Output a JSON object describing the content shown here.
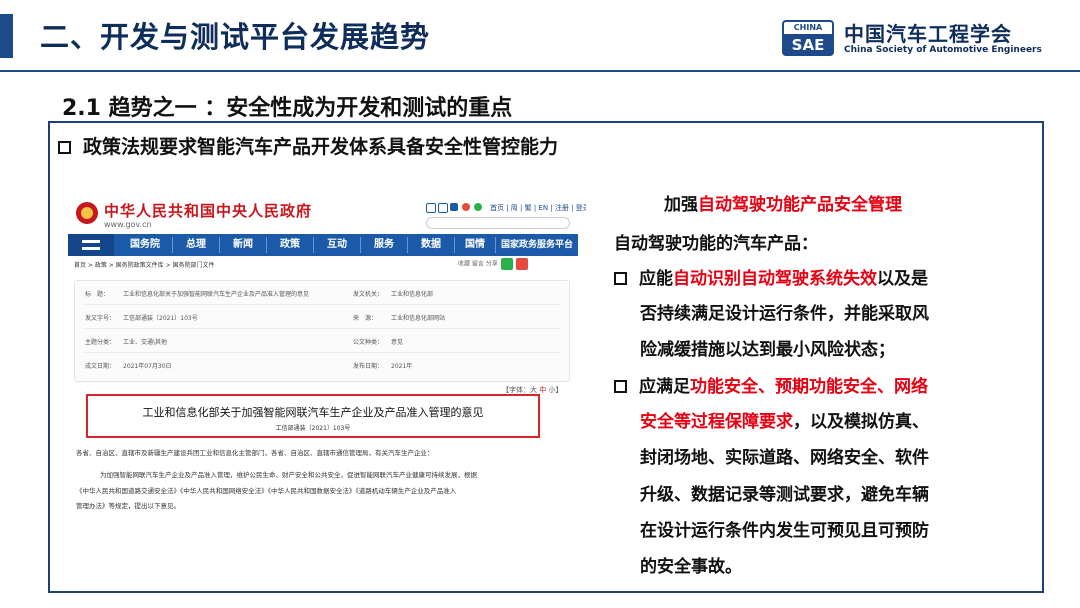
{
  "header": {
    "title": "二、开发与测试平台发展趋势",
    "logo": {
      "badge_top": "CHINA",
      "badge_bottom": "SAE",
      "name_cn": "中国汽车工程学会",
      "name_en": "China Society of Automotive Engineers"
    }
  },
  "subtitle": "2.1 趋势之一 ：安全性成为开发和测试的重点",
  "section_heading": "政策法规要求智能汽车产品开发体系具备安全性管控能力",
  "gov_page": {
    "site_name": "中华人民共和国中央人民政府",
    "site_url": "www.gov.cn",
    "top_links": "首页 | 简 | 繁 | EN | 注册 | 登录",
    "nav": [
      "国务院",
      "总理",
      "新闻",
      "政策",
      "互动",
      "服务",
      "数据",
      "国情",
      "国家政务服务平台"
    ],
    "breadcrumb": "首页 > 政策 > 国务院政策文件库 > 国务院部门文件",
    "tools": "收藏  留言  分享",
    "meta": [
      {
        "label": "标　题：",
        "value": "工业和信息化部关于加强智能网联汽车生产企业及产品准入管理的意见",
        "label2": "发文机关：",
        "value2": "工业和信息化部"
      },
      {
        "label": "发文字号：",
        "value": "工信部通装〔2021〕103号",
        "label2": "来　源：",
        "value2": "工业和信息化部网站"
      },
      {
        "label": "主题分类：",
        "value": "工业、交通\\其他",
        "label2": "公文种类：",
        "value2": "意见"
      },
      {
        "label": "成文日期：",
        "value": "2021年07月30日",
        "label2": "发布日期：",
        "value2": "2021年"
      }
    ],
    "font_size_label": "【字体：",
    "font_sizes": [
      "大",
      "中",
      "小"
    ],
    "font_size_end": "】",
    "doc_title": "工业和信息化部关于加强智能网联汽车生产企业及产品准入管理的意见",
    "doc_number": "工信部通装〔2021〕103号",
    "paragraphs": [
      "各省、自治区、直辖市及新疆生产建设兵团工业和信息化主管部门，各省、自治区、直辖市通信管理局，有关汽车生产企业：",
      "为加强智能网联汽车生产企业及产品准入管理，维护公民生命、财产安全和公共安全，促进智能网联汽车产业健康可持续发展，根据",
      "《中华人民共和国道路交通安全法》《中华人民共和国网络安全法》《中华人民共和国数据安全法》《道路机动车辆生产企业及产品准入",
      "管理办法》等规定，提出以下意见。"
    ]
  },
  "right_panel": {
    "heading_prefix": "加强",
    "heading_red": "自动驾驶功能产品安全管理",
    "intro": "自动驾驶功能的汽车产品：",
    "b1_l1_a": "应能",
    "b1_l1_red": "自动识别自动驾驶系统失效",
    "b1_l1_b": "以及是",
    "b1_l2": "否持续满足设计运行条件，并能采取风",
    "b1_l3": "险减缓措施以达到最小风险状态；",
    "b2_l1_a": "应满足",
    "b2_l1_red": "功能安全、预期功能安全、网络",
    "b2_l2_red": "安全等过程保障要求",
    "b2_l2_b": "，以及模拟仿真、",
    "b2_l3": "封闭场地、实际道路、网络安全、软件",
    "b2_l4": "升级、数据记录等测试要求，避免车辆",
    "b2_l5": "在设计运行条件内发生可预见且可预防",
    "b2_l6": "的安全事故。"
  },
  "colors": {
    "primary": "#1e4a8c",
    "highlight": "#e60012",
    "gov_red": "#c8161d",
    "gov_nav": "#1b5aa8"
  }
}
